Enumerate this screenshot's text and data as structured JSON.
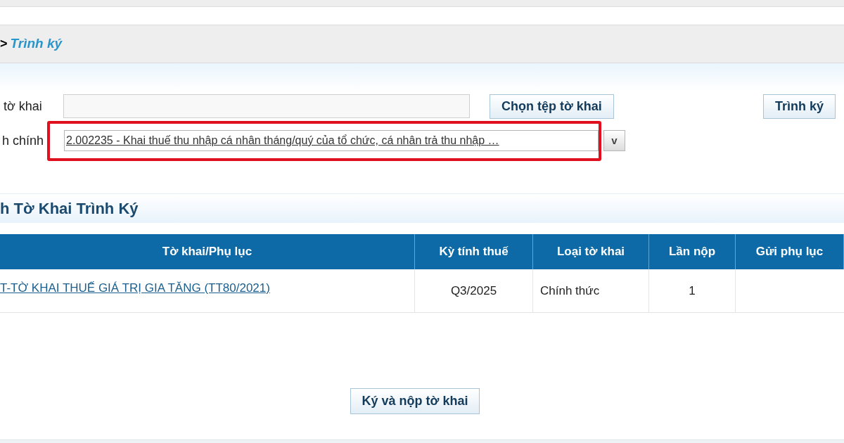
{
  "breadcrumb": {
    "separator": ">",
    "current": "Trình ký"
  },
  "form": {
    "file_label": "tờ khai",
    "choose_button": "Chọn tệp tờ khai",
    "submit_button": "Trình ký",
    "procedure_label": "h chính",
    "procedure_value": "2.002235 - Khai thuế thu nhập cá nhân tháng/quý của tổ chức, cá nhân trả thu nhập …",
    "procedure_highlighted": true,
    "dropdown_button": "v"
  },
  "section_title": "h Tờ Khai Trình Ký",
  "table": {
    "columns": [
      "Tờ khai/Phụ lục",
      "Kỳ tính thuế",
      "Loại tờ khai",
      "Lần nộp",
      "Gửi phụ lục"
    ],
    "rows": [
      {
        "declaration": "T-TỜ KHAI THUẾ GIÁ TRỊ GIA TĂNG (TT80/2021)",
        "period": "Q3/2025",
        "type": "Chính thức",
        "submission": "1",
        "appendix": ""
      }
    ]
  },
  "sign_button": "Ký và nộp tờ khai"
}
